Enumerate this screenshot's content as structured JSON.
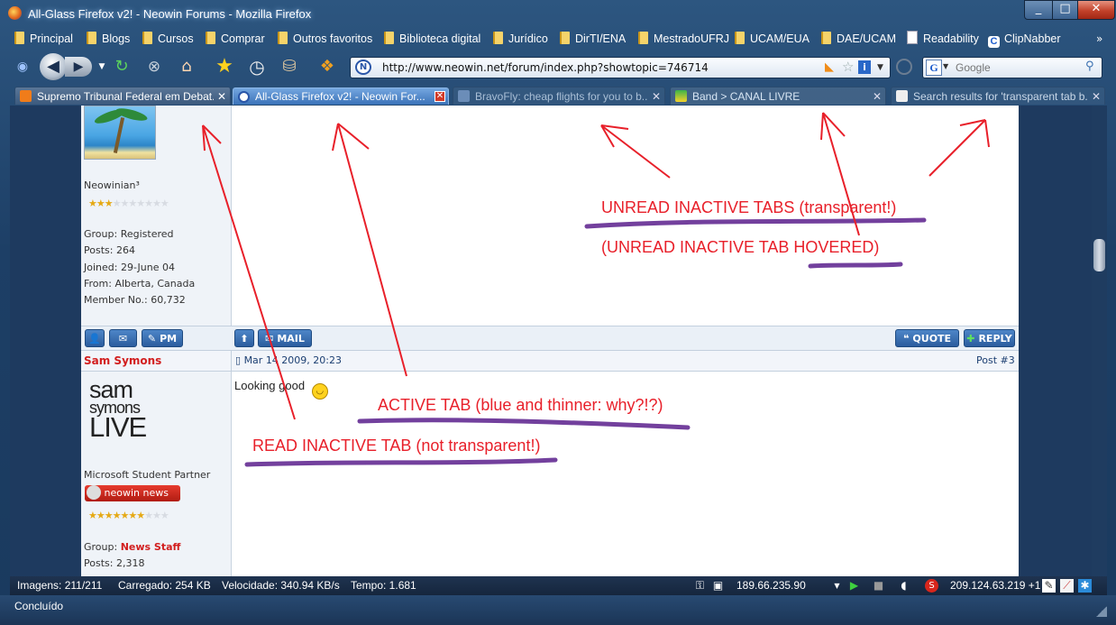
{
  "window": {
    "title": "All-Glass Firefox v2! - Neowin Forums - Mozilla Firefox"
  },
  "bookmarks": [
    {
      "label": "Principal",
      "icon": "folder-icon"
    },
    {
      "label": "Blogs",
      "icon": "folder-icon"
    },
    {
      "label": "Cursos",
      "icon": "folder-icon"
    },
    {
      "label": "Comprar",
      "icon": "folder-icon"
    },
    {
      "label": "Outros favoritos",
      "icon": "folder-icon"
    },
    {
      "label": "Biblioteca digital",
      "icon": "folder-icon"
    },
    {
      "label": "Jurídico",
      "icon": "folder-icon"
    },
    {
      "label": "DirTI/ENA",
      "icon": "folder-icon"
    },
    {
      "label": "MestradoUFRJ",
      "icon": "folder-icon"
    },
    {
      "label": "UCAM/EUA",
      "icon": "folder-icon"
    },
    {
      "label": "DAE/UCAM",
      "icon": "folder-icon"
    },
    {
      "label": "Readability",
      "icon": "page-icon"
    },
    {
      "label": "ClipNabber",
      "icon": "clipnabber-icon"
    }
  ],
  "bookmarks_overflow": "»",
  "navbar": {
    "url": "http://www.neowin.net/forum/index.php?showtopic=746714",
    "search_placeholder": "Google",
    "google_glyph": "G"
  },
  "tabs": [
    {
      "label": "Supremo Tribunal Federal em Debat...",
      "state": "inactive-read"
    },
    {
      "label": "All-Glass Firefox v2! - Neowin For...",
      "state": "active"
    },
    {
      "label": "BravoFly: cheap flights for you to b...",
      "state": "inactive-unread"
    },
    {
      "label": "Band > CANAL LIVRE",
      "state": "inactive-unread-hovered"
    },
    {
      "label": "Search results for 'transparent tab b...",
      "state": "inactive-unread"
    }
  ],
  "post_prev": {
    "title": "Neowinian³",
    "stars_on": 3,
    "stars_total": 10,
    "group": "Group: Registered",
    "posts": "Posts: 264",
    "joined": "Joined: 29-June 04",
    "from": "From: Alberta, Canada",
    "member_no": "Member No.: 60,732"
  },
  "buttons": {
    "pm": "PM",
    "mail": "MAIL",
    "quote": "QUOTE",
    "reply": "REPLY"
  },
  "post3": {
    "author": "Sam Symons",
    "date": "Mar 14 2009, 20:23",
    "post_prefix": "Post ",
    "post_num": "#3",
    "body": "Looking good",
    "avatar_lines": [
      "sam",
      "symons",
      "LIVE"
    ],
    "title": "Microsoft Student Partner",
    "badge": "neowin news",
    "stars_on": 7,
    "stars_total": 10,
    "group_prefix": "Group: ",
    "group": "News Staff",
    "posts": "Posts: 2,318"
  },
  "annotations": {
    "unread": "UNREAD INACTIVE TABS (transparent!)",
    "unread_hovered": "(UNREAD INACTIVE TAB HOVERED)",
    "active": "ACTIVE TAB (blue and thinner: why?!?)",
    "read": "READ INACTIVE TAB (not transparent!)",
    "annotation_color": "#e8202a",
    "underline_color": "#5a1f8c"
  },
  "addonbar": {
    "images": "Imagens: 211/211",
    "loaded": "Carregado: 254 KB",
    "speed": "Velocidade: 340.94 KB/s",
    "time": "Tempo: 1.681",
    "ip1": "189.66.235.90",
    "ip2": "209.124.63.219 +1"
  },
  "statusbar": {
    "text": "Concluído"
  }
}
